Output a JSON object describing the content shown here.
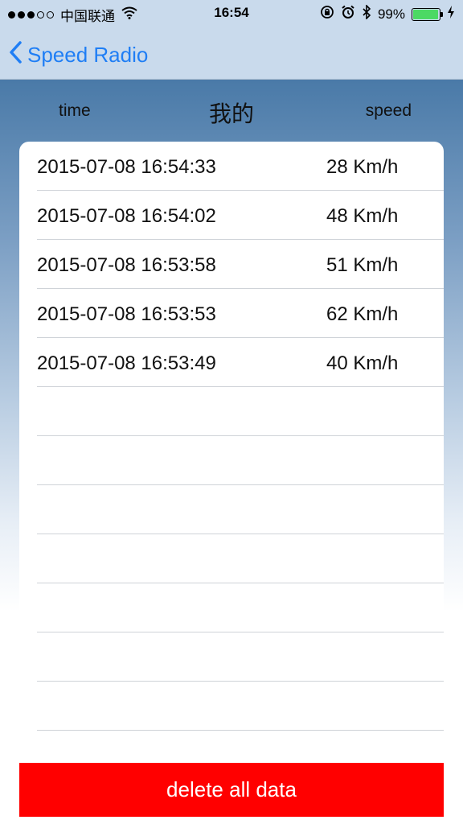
{
  "status_bar": {
    "carrier": "中国联通",
    "time": "16:54",
    "battery": "99%"
  },
  "nav": {
    "back_label": "Speed Radio"
  },
  "header": {
    "time_label": "time",
    "title": "我的",
    "speed_label": "speed"
  },
  "records": [
    {
      "time": "2015-07-08 16:54:33",
      "speed": "28 Km/h"
    },
    {
      "time": "2015-07-08 16:54:02",
      "speed": "48 Km/h"
    },
    {
      "time": "2015-07-08 16:53:58",
      "speed": "51 Km/h"
    },
    {
      "time": "2015-07-08 16:53:53",
      "speed": "62 Km/h"
    },
    {
      "time": "2015-07-08 16:53:49",
      "speed": "40 Km/h"
    },
    {
      "time": "",
      "speed": ""
    },
    {
      "time": "",
      "speed": ""
    },
    {
      "time": "",
      "speed": ""
    },
    {
      "time": "",
      "speed": ""
    },
    {
      "time": "",
      "speed": ""
    },
    {
      "time": "",
      "speed": ""
    },
    {
      "time": "",
      "speed": ""
    }
  ],
  "actions": {
    "delete_label": "delete all data"
  },
  "colors": {
    "accent": "#1f7ef5",
    "danger": "#ff0000",
    "battery": "#4cd964"
  }
}
